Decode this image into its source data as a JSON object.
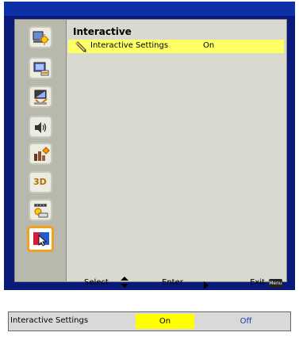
{
  "menu": {
    "title": "Interactive",
    "items": [
      {
        "label": "Interactive Settings",
        "value": "On"
      }
    ]
  },
  "sidebar": {
    "icons": [
      "image-settings-icon",
      "display-icon",
      "setup-icon",
      "audio-icon",
      "options-icon",
      "3d-icon",
      "lan-icon",
      "interactive-icon"
    ],
    "three_d_label": "3D",
    "active_index": 7
  },
  "footer": {
    "select_label": "Select",
    "enter_label": "Enter",
    "exit_label": "Exit",
    "menu_key": "Menu"
  },
  "submenu": {
    "label": "Interactive Settings",
    "option_on": "On",
    "option_off": "Off",
    "selected": "On"
  },
  "colors": {
    "highlight": "#ffff66",
    "selected_option": "#ffff00",
    "active_icon_border": "#f2a21a",
    "window_frame": "#0a1a7a",
    "unselected_option_text": "#1a3cb0"
  }
}
